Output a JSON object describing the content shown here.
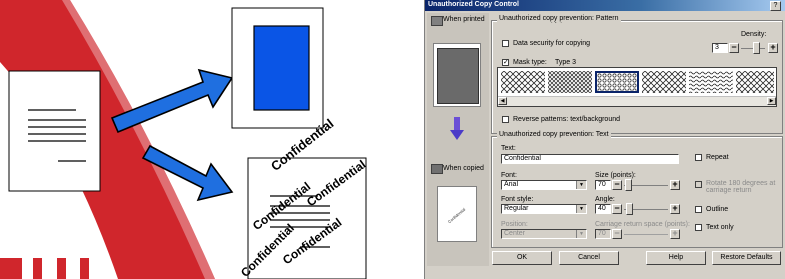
{
  "dialog": {
    "title": "Unauthorized Copy Control",
    "help_label": "?",
    "when_printed_label": "When printed",
    "when_copied_label": "When copied",
    "pattern_group": {
      "title": "Unauthorized copy prevention: Pattern",
      "data_security_label": "Data security for copying",
      "density_label": "Density:",
      "density_value": "3",
      "mask_type_label": "Mask type:",
      "mask_type_value": "Type 3",
      "reverse_label": "Reverse patterns: text/background"
    },
    "text_group": {
      "title": "Unauthorized copy prevention: Text",
      "text_label": "Text:",
      "text_value": "Confidential",
      "font_label": "Font:",
      "font_value": "Arial",
      "size_label": "Size (points):",
      "size_value": "70",
      "font_style_label": "Font style:",
      "font_style_value": "Regular",
      "angle_label": "Angle:",
      "angle_value": "40",
      "position_label": "Position:",
      "position_value": "Center",
      "carriage_label": "Carriage return space (points):",
      "carriage_value": "70",
      "repeat_label": "Repeat",
      "rotate_label": "Rotate 180 degrees at carriage return",
      "outline_label": "Outline",
      "text_only_label": "Text only"
    },
    "buttons": {
      "ok": "OK",
      "cancel": "Cancel",
      "help": "Help",
      "restore": "Restore Defaults"
    },
    "preview_copy_text": "Confidential"
  },
  "illustration": {
    "watermark_word": "Confidential",
    "colors": {
      "blue": "#0a55e6",
      "red": "#d0262c",
      "arrow": "#1f6fe0"
    }
  }
}
